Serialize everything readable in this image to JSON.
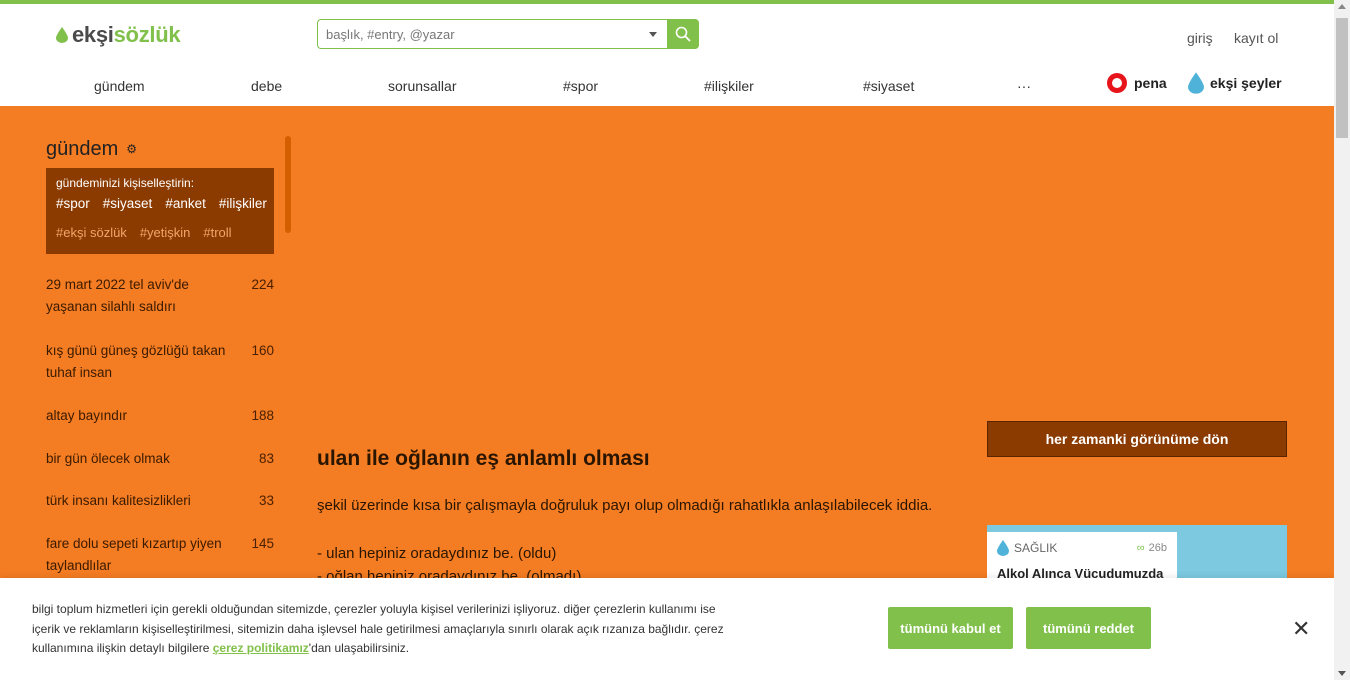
{
  "header": {
    "logo_part1": "ekşi",
    "logo_part2": "sözlük",
    "search_placeholder": "başlık, #entry, @yazar",
    "login": "giriş",
    "register": "kayıt ol"
  },
  "nav": {
    "items": [
      "gündem",
      "debe",
      "sorunsallar",
      "#spor",
      "#ilişkiler",
      "#siyaset",
      "···"
    ],
    "pena": "pena",
    "eksi_seyler": "ekşi şeyler"
  },
  "sidebar": {
    "title": "gündem",
    "personalize_hint": "gündeminizi kişiselleştirin:",
    "tags_primary": [
      "#spor",
      "#siyaset",
      "#anket",
      "#ilişkiler"
    ],
    "tags_secondary": [
      "#ekşi sözlük",
      "#yetişkin",
      "#troll"
    ],
    "topics": [
      {
        "title": "29 mart 2022 tel aviv'de yaşanan silahlı saldırı",
        "count": "224"
      },
      {
        "title": "kış günü güneş gözlüğü takan tuhaf insan",
        "count": "160"
      },
      {
        "title": "altay bayındır",
        "count": "188"
      },
      {
        "title": "bir gün ölecek olmak",
        "count": "83"
      },
      {
        "title": "türk insanı kalitesizlikleri",
        "count": "33"
      },
      {
        "title": "fare dolu sepeti kızartıp yiyen taylandlılar",
        "count": "145"
      }
    ]
  },
  "entry": {
    "title": "ulan ile oğlanın eş anlamlı olması",
    "line1": "şekil üzerinde kısa bir çalışmayla doğruluk payı olup olmadığı rahatlıkla anlaşılabilecek iddia.",
    "line2": "- ulan hepiniz oradaydınız be. (oldu)",
    "line3": "- oğlan hepiniz oradaydınız be. (olmadı)"
  },
  "right": {
    "back_button": "her zamanki görünüme dön",
    "card_category": "SAĞLIK",
    "card_time": "26b",
    "card_title": "Alkol Alınca Vücudumuzda"
  },
  "cookie": {
    "text_part1": "bilgi toplum hizmetleri için gerekli olduğundan sitemizde, çerezler yoluyla kişisel verilerinizi işliyoruz. diğer çerezlerin kullanımı ise içerik ve reklamların kişiselleştirilmesi, sitemizin daha işlevsel hale getirilmesi amaçlarıyla sınırlı olarak açık rızanıza bağlıdır. çerez kullanımına ilişkin detaylı bilgilere ",
    "link": "çerez politikamız",
    "text_part2": "'dan ulaşabilirsiniz.",
    "accept": "tümünü kabul et",
    "reject": "tümünü reddet",
    "close": "✕"
  },
  "colors": {
    "accent_green": "#81c14b",
    "background_orange": "#f47c22",
    "dark_brown": "#8c3b00"
  }
}
